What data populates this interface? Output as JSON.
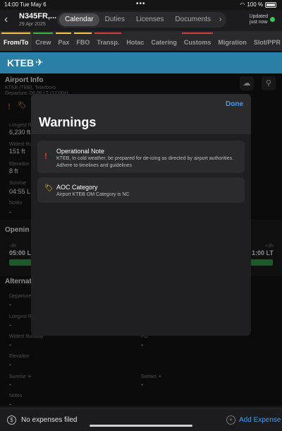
{
  "status": {
    "time": "14:00  Tue May 6",
    "dots": "•••",
    "battery": "100 %"
  },
  "header": {
    "back": "‹",
    "flight": "N345FR,...",
    "date": "29 Apr 2025",
    "segments": [
      "Calendar",
      "Duties",
      "Licenses",
      "Documents"
    ],
    "chevron": "›",
    "updated_line1": "Updated",
    "updated_line2": "just now",
    "status_color": "#35c759"
  },
  "tabs": [
    {
      "label": "From/To",
      "active": true,
      "color": "#f2c744"
    },
    {
      "label": "Crew",
      "color": "#3bb54a"
    },
    {
      "label": "Pax",
      "color": "#f2c744"
    },
    {
      "label": "FBO",
      "color": "#f2c744"
    },
    {
      "label": "Transp.",
      "color": "#d83b3b"
    },
    {
      "label": "Hotac",
      "color": ""
    },
    {
      "label": "Catering",
      "color": ""
    },
    {
      "label": "Customs",
      "color": "#d83b3b"
    },
    {
      "label": "Migration",
      "color": ""
    },
    {
      "label": "Slot/PPR",
      "color": ""
    }
  ],
  "airport": {
    "code": "KTEB",
    "icon": "plane-icon"
  },
  "background": {
    "section1": "Airport Info",
    "sub1": "KTEB (TEB), Teterboro",
    "sub2": "Departure: 06:00 LT (12:00z)",
    "warn_icon": "!",
    "tag_icon": "🏷",
    "longest_label": "Longest R",
    "longest_val": "6,230 ft",
    "widest_label": "Widest Ru",
    "widest_val": "151 ft",
    "elev_label": "Elevation",
    "elev_val": "8 ft",
    "sunrise_label": "Sunrise",
    "sunrise_val": "04:55 L",
    "notes_label": "Notes",
    "notes_val": "-",
    "opening": "Openin",
    "open_left_small": "-3h",
    "open_left": "05:00 L",
    "open_right_small": "+3h",
    "open_right": "1:00 LT",
    "alternate": "Alternat",
    "alt_departure": "Departure",
    "alt_dash": "-",
    "alt_longest": "Longest R",
    "alt_widest": "Widest Runway",
    "alt_fo": "FO",
    "alt_elev": "Elevation",
    "alt_sunrise": "Sunrise ☀",
    "alt_sunset": "Sunset ☀",
    "alt_notes": "Notes"
  },
  "modal": {
    "done": "Done",
    "title": "Warnings",
    "items": [
      {
        "icon": "!",
        "title": "Operational Note",
        "desc": "KTEB, In cold weather, be prepared for de-icing as directed by airport authorities. Adhere to timelines and guidelines"
      },
      {
        "icon": "🏷",
        "title": "AOC Category",
        "desc": "Airport KTEB OM Category is NC"
      }
    ]
  },
  "footer": {
    "no_expenses": "No expenses filed",
    "add_expense": "Add Expense",
    "dollar": "$",
    "plus": "+"
  }
}
